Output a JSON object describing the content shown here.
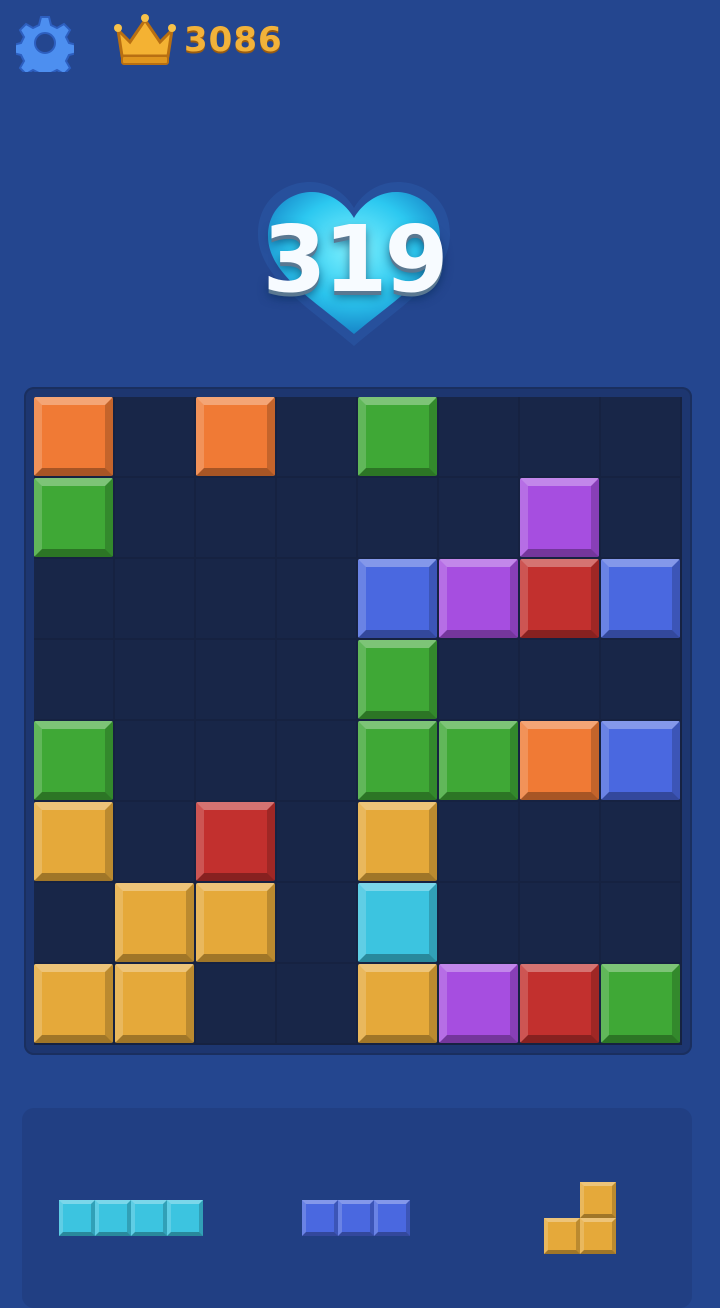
{
  "header": {
    "best_score": "3086",
    "icons": [
      "gear-icon",
      "crown-icon"
    ]
  },
  "score": {
    "value": "319",
    "badge_icon": "heart-icon"
  },
  "colors": {
    "orange": "#f07a35",
    "green": "#3fa836",
    "purple": "#a64ee0",
    "blue": "#4a68e0",
    "red": "#c2302e",
    "yellow": "#e5a93a",
    "cyan": "#3cc4e0"
  },
  "board": {
    "rows": 8,
    "cols": 8,
    "cells": [
      [
        "orange",
        null,
        "orange",
        null,
        "green",
        null,
        null,
        null
      ],
      [
        "green",
        null,
        null,
        null,
        null,
        null,
        "purple",
        null
      ],
      [
        null,
        null,
        null,
        null,
        "blue",
        "purple",
        "red",
        "blue"
      ],
      [
        null,
        null,
        null,
        null,
        "green",
        null,
        null,
        null
      ],
      [
        "green",
        null,
        null,
        null,
        "green",
        "green",
        "orange",
        "blue"
      ],
      [
        "yellow",
        null,
        "red",
        null,
        "yellow",
        null,
        null,
        null
      ],
      [
        null,
        "yellow",
        "yellow",
        null,
        "cyan",
        null,
        null,
        null
      ],
      [
        "yellow",
        "yellow",
        null,
        null,
        "yellow",
        "purple",
        "red",
        "green"
      ]
    ]
  },
  "tray": {
    "pieces": [
      {
        "name": "i4-horizontal",
        "color": "cyan",
        "shape": [
          [
            1,
            1,
            1,
            1
          ]
        ]
      },
      {
        "name": "i3-horizontal",
        "color": "blue",
        "shape": [
          [
            1,
            1,
            1
          ]
        ]
      },
      {
        "name": "j-shape",
        "color": "yellow",
        "shape": [
          [
            0,
            1
          ],
          [
            1,
            1
          ]
        ]
      }
    ]
  }
}
